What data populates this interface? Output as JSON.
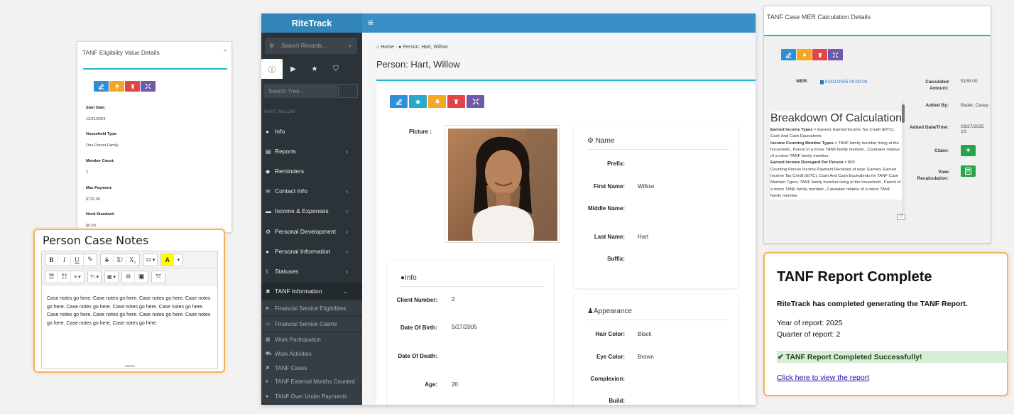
{
  "eligibility": {
    "title": "TANF Eligibility Value Details",
    "close": "×",
    "fields": [
      {
        "label": "Start Date:",
        "value": "12/31/2024"
      },
      {
        "label": "Household Type:",
        "value": "One Parent Family"
      },
      {
        "label": "Member Count:",
        "value": "2"
      },
      {
        "label": "Max Payment:",
        "value": "$720.00"
      },
      {
        "label": "Need Standard:",
        "value": "$0.00"
      }
    ]
  },
  "notes": {
    "title": "Person Case Notes",
    "toolbar": {
      "bold": "B",
      "italic": "I",
      "underline": "U",
      "eraser": "✎",
      "strike": "S",
      "superscript": "X²",
      "subscript": "X₂",
      "font_size": "12 ▾",
      "color": "A",
      "color_caret": "▾",
      "ul": "☰",
      "ol": "☷",
      "align": "≡ ▾",
      "style": "T⁝ ▾",
      "table": "▦ ▾",
      "link": "⊖",
      "image": "▣",
      "fullscreen": "⤧"
    },
    "body": "Case notes go here. Case notes go here. Case notes go here. Case notes go here. Case notes go here. Case notes go here. Case notes go here. Case notes go here. Case notes go here. Case notes go here. Case notes go here. Case notes go here. Case notes go here."
  },
  "app": {
    "brand": "RiteTrack",
    "hamburger": "≡",
    "search_placeholder": "Search Records...",
    "tree_placeholder": "Search Tree...",
    "user_name": "HART, WILLOW",
    "nav": [
      {
        "label": "Info",
        "icon": "person-icon",
        "chev": false
      },
      {
        "label": "Reports",
        "icon": "reports-icon",
        "chev": true
      },
      {
        "label": "Reminders",
        "icon": "reminders-icon",
        "chev": false
      },
      {
        "label": "Contact Info",
        "icon": "contact-icon",
        "chev": true
      },
      {
        "label": "Income & Expenses",
        "icon": "income-icon",
        "chev": true
      },
      {
        "label": "Personal Development",
        "icon": "development-icon",
        "chev": true
      },
      {
        "label": "Personal Information",
        "icon": "information-icon",
        "chev": true
      },
      {
        "label": "Statuses",
        "icon": "statuses-icon",
        "chev": true
      },
      {
        "label": "TANF Information",
        "icon": "tanf-icon",
        "chev": true
      }
    ],
    "sub": [
      "Financial Service Eligibilities",
      "Financial Service Claims",
      "Work Participation",
      "Work Activities",
      "TANF Cases",
      "TANF External Months Counted",
      "TANF Over Under Payments"
    ],
    "breadcrumb": {
      "home": "Home",
      "sep": "›",
      "current": "Person: Hart, Willow"
    },
    "page_title": "Person: Hart, Willow",
    "picture_label": "Picture :",
    "name_panel": {
      "title": "Name",
      "fields": [
        {
          "label": "Prefix:",
          "value": ""
        },
        {
          "label": "First Name:",
          "value": "Willow"
        },
        {
          "label": "Middle Name:",
          "value": ""
        },
        {
          "label": "Last Name:",
          "value": "Hart"
        },
        {
          "label": "Suffix:",
          "value": ""
        }
      ]
    },
    "info_panel": {
      "title": "Info",
      "fields": [
        {
          "label": "Client Number:",
          "value": "2"
        },
        {
          "label": "Date Of Birth:",
          "value": "5/27/2005"
        },
        {
          "label": "Date Of Death:",
          "value": ""
        },
        {
          "label": "Age:",
          "value": "20"
        }
      ]
    },
    "appearance_panel": {
      "title": "Appearance",
      "fields": [
        {
          "label": "Hair Color:",
          "value": "Black"
        },
        {
          "label": "Eye Color:",
          "value": "Brown"
        },
        {
          "label": "Complexion:",
          "value": ""
        },
        {
          "label": "Build:",
          "value": ""
        }
      ]
    }
  },
  "mer": {
    "title": "TANF Case MER Calculation Details",
    "mer_label": "MER:",
    "mer_value": "01/01/2025 00:00:00",
    "calc_label": "Calculated Amount:",
    "calc_value": "$155.00",
    "added_by_label": "Added By:",
    "added_by_value": "Bader, Casey",
    "added_dt_label": "Added Date/Time:",
    "added_dt_value": "03/27/2025 10:",
    "claim_label": "Claim:",
    "view_label": "View Recalculation:",
    "plus": "+",
    "breakdown_title": "Breakdown Of Calculation",
    "breakdown_lines": [
      {
        "b": "Earned Income Types",
        "t": " = Earned, Earned Income Tax Credit (EITC), Cash And Cash Equivalents"
      },
      {
        "b": "Income Counting Member Types",
        "t": " = TANF family member living at the household., Parent of a minor TANF family member., Caretaker relative of a minor TANF family member."
      },
      {
        "b": "Earned Income Disregard Per Person",
        "t": " = 800"
      },
      {
        "b": "",
        "t": "Counting Person Income Payment Received of type: Earned, Earned Income Tax Credit (EITC), Cash And Cash Equivalents for TANF Case Member Types: TANF family member living at the household., Parent of a minor TANF family member., Caretaker relative of a minor TANF family member."
      }
    ]
  },
  "report": {
    "title": "TANF Report Complete",
    "message": "RiteTrack has completed generating the TANF Report.",
    "year": "Year of report: 2025",
    "quarter": "Quarter of report: 2",
    "success": "✔ TANF Report Completed Successfully!",
    "link": "Click here to view the report"
  }
}
